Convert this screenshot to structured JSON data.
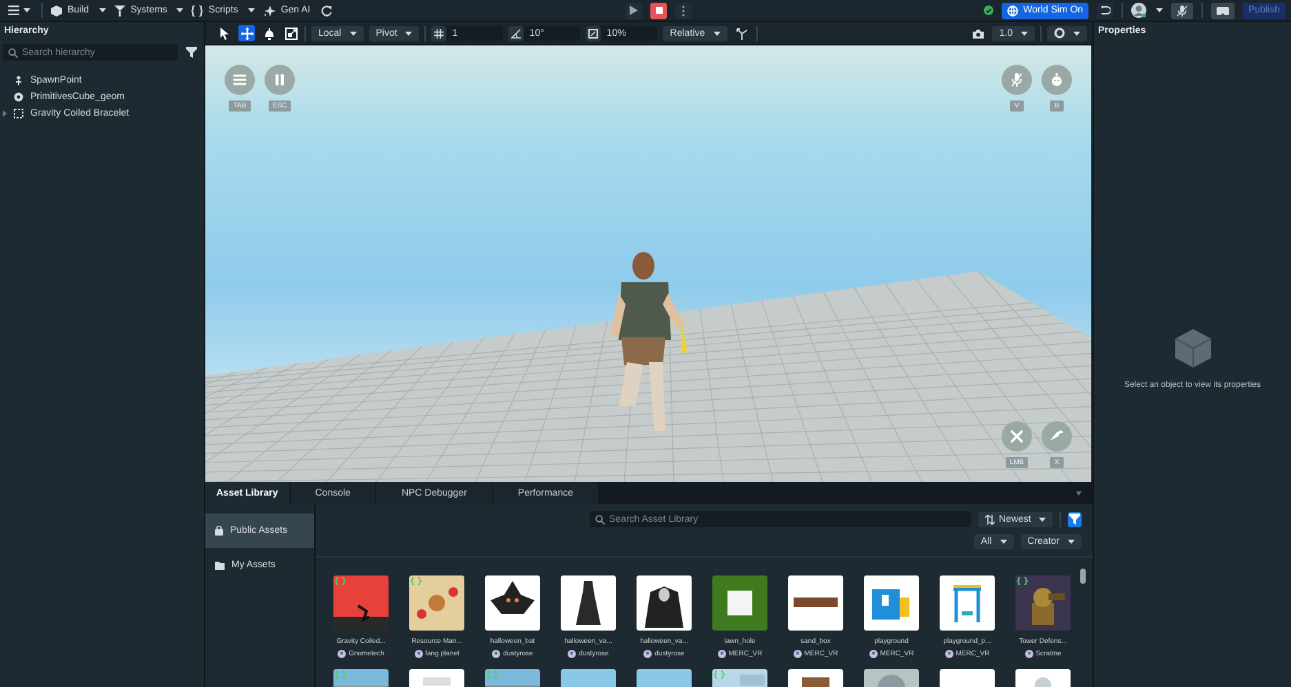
{
  "top_bar": {
    "menus": [
      {
        "label": "Build",
        "kind": "build"
      },
      {
        "label": "Systems",
        "kind": "systems"
      },
      {
        "label": "Scripts",
        "kind": "scripts"
      }
    ],
    "gen_ai": "Gen AI",
    "world_sim": {
      "label": "World Sim On",
      "on": true
    },
    "publish": "Publish"
  },
  "toolbar": {
    "tools": [
      {
        "kind": "select",
        "selected": false
      },
      {
        "kind": "move",
        "selected": true
      },
      {
        "kind": "rotate",
        "selected": false
      },
      {
        "kind": "scale",
        "selected": false
      }
    ],
    "space": "Local",
    "pivot": "Pivot",
    "grid_snap": "1",
    "angle_snap": "10°",
    "scale_snap": "10%",
    "mode": "Relative",
    "camera_speed": "1.0"
  },
  "hierarchy": {
    "title": "Hierarchy",
    "search_placeholder": "Search hierarchy",
    "items": [
      {
        "label": "SpawnPoint",
        "kind": "spawn"
      },
      {
        "label": "PrimitivesCube_geom",
        "kind": "mesh"
      },
      {
        "label": "Gravity Coiled Bracelet",
        "kind": "group",
        "expanded": false
      }
    ]
  },
  "viewport": {
    "control_groups": [
      {
        "controls": [
          {
            "kind": "menu",
            "key": "TAB"
          },
          {
            "kind": "pause",
            "key": "ESC"
          }
        ]
      },
      {
        "controls": [
          {
            "kind": "mic-off",
            "key": "V"
          },
          {
            "kind": "emote",
            "key": "B"
          }
        ]
      },
      {
        "controls": [
          {
            "kind": "close",
            "key": "LMB"
          },
          {
            "kind": "throw",
            "key": "X"
          }
        ]
      }
    ]
  },
  "properties": {
    "title": "Properties",
    "empty_message": "Select an object to view its properties"
  },
  "bottom_panel": {
    "tabs": [
      {
        "label": "Asset Library",
        "selected": true
      },
      {
        "label": "Console",
        "selected": false
      },
      {
        "label": "NPC Debugger",
        "selected": false
      },
      {
        "label": "Performance",
        "selected": false
      }
    ],
    "sidebar": [
      {
        "label": "Public Assets",
        "kind": "public",
        "selected": true
      },
      {
        "label": "My Assets",
        "kind": "folder",
        "selected": false
      }
    ],
    "search_placeholder": "Search Asset Library",
    "sort": "Newest",
    "filter_active": true,
    "type_filter": "All",
    "creator_filter": "Creator",
    "assets": [
      {
        "name": "Gravity Coiled...",
        "creator": "Gnometech",
        "scripted": true,
        "kind": "picture"
      },
      {
        "name": "Resource Man...",
        "creator": "fang.planet",
        "scripted": true,
        "kind": "picture"
      },
      {
        "name": "halloween_bat",
        "creator": "dustyrose",
        "scripted": false,
        "kind": "picture"
      },
      {
        "name": "halloween_va...",
        "creator": "dustyrose",
        "scripted": false,
        "kind": "picture"
      },
      {
        "name": "halloween_va...",
        "creator": "dustyrose",
        "scripted": false,
        "kind": "picture"
      },
      {
        "name": "lawn_hole",
        "creator": "MERC_VR",
        "scripted": false,
        "kind": "picture"
      },
      {
        "name": "sand_box",
        "creator": "MERC_VR",
        "scripted": false,
        "kind": "picture"
      },
      {
        "name": "playground",
        "creator": "MERC_VR",
        "scripted": false,
        "kind": "picture"
      },
      {
        "name": "playground_p...",
        "creator": "MERC_VR",
        "scripted": false,
        "kind": "picture"
      },
      {
        "name": "Tower Defens...",
        "creator": "Scratme",
        "scripted": true,
        "kind": "picture"
      }
    ],
    "assets_row_2": [
      {
        "kind": "picture",
        "scripted": true
      },
      {
        "kind": "picture",
        "scripted": false
      },
      {
        "kind": "picture",
        "scripted": true
      },
      {
        "kind": "picture",
        "scripted": false
      },
      {
        "kind": "picture",
        "scripted": false
      },
      {
        "kind": "picture",
        "scripted": true
      },
      {
        "kind": "picture",
        "scripted": false
      },
      {
        "kind": "picture",
        "scripted": false
      },
      {
        "kind": "picture",
        "scripted": false
      },
      {
        "kind": "picture",
        "scripted": false
      }
    ]
  }
}
